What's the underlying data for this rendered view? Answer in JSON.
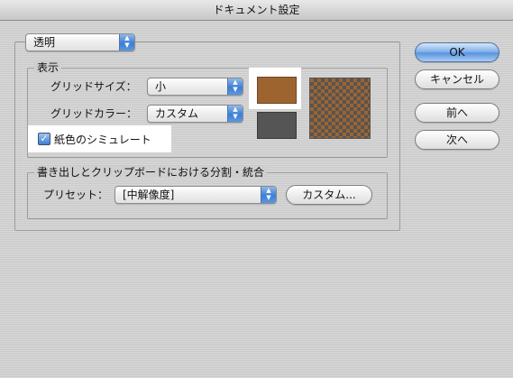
{
  "window": {
    "title": "ドキュメント設定"
  },
  "section_popup": {
    "value": "透明"
  },
  "display": {
    "legend": "表示",
    "grid_size_label": "グリッドサイズ：",
    "grid_size_value": "小",
    "grid_color_label": "グリッドカラー：",
    "grid_color_value": "カスタム",
    "simulate_paper_label": "紙色のシミュレート",
    "simulate_paper_checked": true,
    "swatch_colors": {
      "grid_color_1": "#9e6430",
      "grid_color_2": "#555555"
    }
  },
  "flatten": {
    "legend": "書き出しとクリップボードにおける分割・統合",
    "preset_label": "プリセット：",
    "preset_value": "[中解像度]",
    "custom_button": "カスタム..."
  },
  "buttons": {
    "ok": "OK",
    "cancel": "キャンセル",
    "prev": "前へ",
    "next": "次へ"
  },
  "stepper_glyphs": {
    "up": "▲",
    "down": "▼"
  },
  "check_glyph": "✓"
}
